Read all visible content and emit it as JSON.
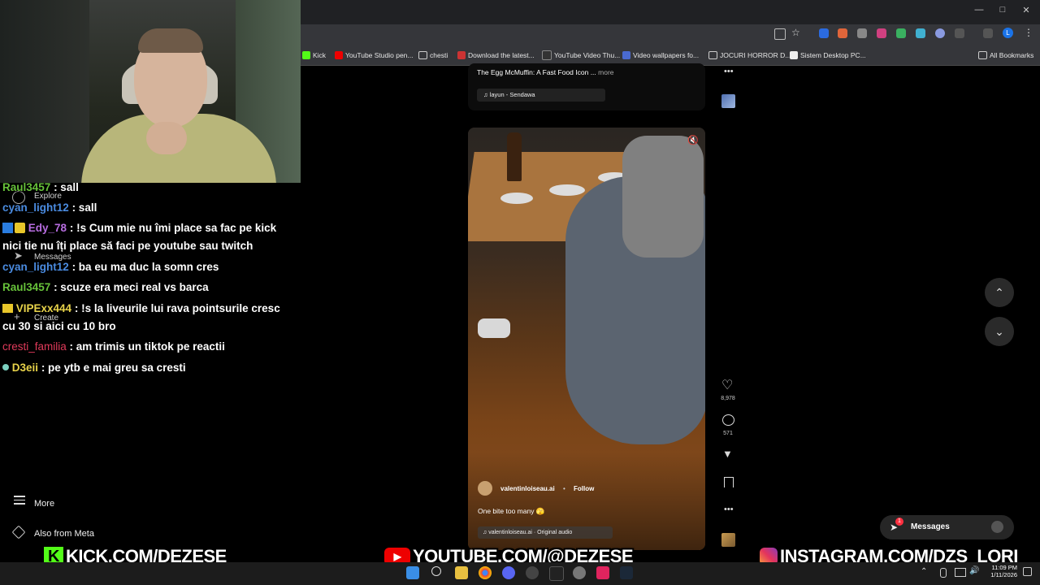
{
  "browser": {
    "bookmarks": [
      "Kick",
      "YouTube Studio pen...",
      "chesti",
      "Download the latest...",
      "YouTube Video Thu...",
      "Video wallpapers fo...",
      "JOCURI HORROR D...",
      "Sistem Desktop PC..."
    ],
    "all_bookmarks": "All Bookmarks"
  },
  "chat": [
    {
      "user": "Raul3457",
      "text": ": sall",
      "color": "#67c23a"
    },
    {
      "user": "cyan_light12",
      "text": ": sall",
      "color": "#4a8be0"
    },
    {
      "user": "Edy_78",
      "text": ": !s Cum mie nu îmi place sa fac pe kick",
      "cont": "nici tie nu îți place să faci pe youtube sau twitch",
      "color": "#b76de0"
    },
    {
      "user": "cyan_light12",
      "text": ": ba eu ma duc la somn cres",
      "color": "#4a8be0"
    },
    {
      "user": "Raul3457",
      "text": ": scuze era meci real vs barca",
      "color": "#67c23a"
    },
    {
      "user": "VIPExx444",
      "text": ": !s la liveurile lui rava pointsurile cresc",
      "cont": "cu 30 si aici cu 10 bro",
      "color": "#e8d34a"
    },
    {
      "user": "cresti_familia",
      "text": ": am trimis un tiktok pe reactii",
      "color": "#e03a5a"
    },
    {
      "user": "D3eii",
      "text": ": pe ytb e mai greu sa cresti",
      "color": "#e8d34a"
    }
  ],
  "sidebar": {
    "explore": "Explore",
    "messages": "Messages",
    "create": "Create",
    "more": "More",
    "also_from_meta": "Also from Meta"
  },
  "prev_post": {
    "caption": "The Egg McMuffin: A Fast Food Icon ...",
    "more": "more",
    "audio": "layun - Sendawa"
  },
  "post": {
    "username": "valentinloiseau.ai",
    "follow": "Follow",
    "caption": "One bite too many 🫣",
    "audio": "valentinloiseau.ai · Original audio",
    "likes": "8,978",
    "comments": "571"
  },
  "messages_button": {
    "label": "Messages",
    "badge": "1"
  },
  "overlay": {
    "kick": "KICK.COM/DEZESE",
    "youtube": "YOUTUBE.COM/@DEZESE",
    "instagram": "INSTAGRAM.COM/DZS_LORI"
  },
  "taskbar": {
    "time": "11:09 PM",
    "date": "1/11/2026"
  }
}
